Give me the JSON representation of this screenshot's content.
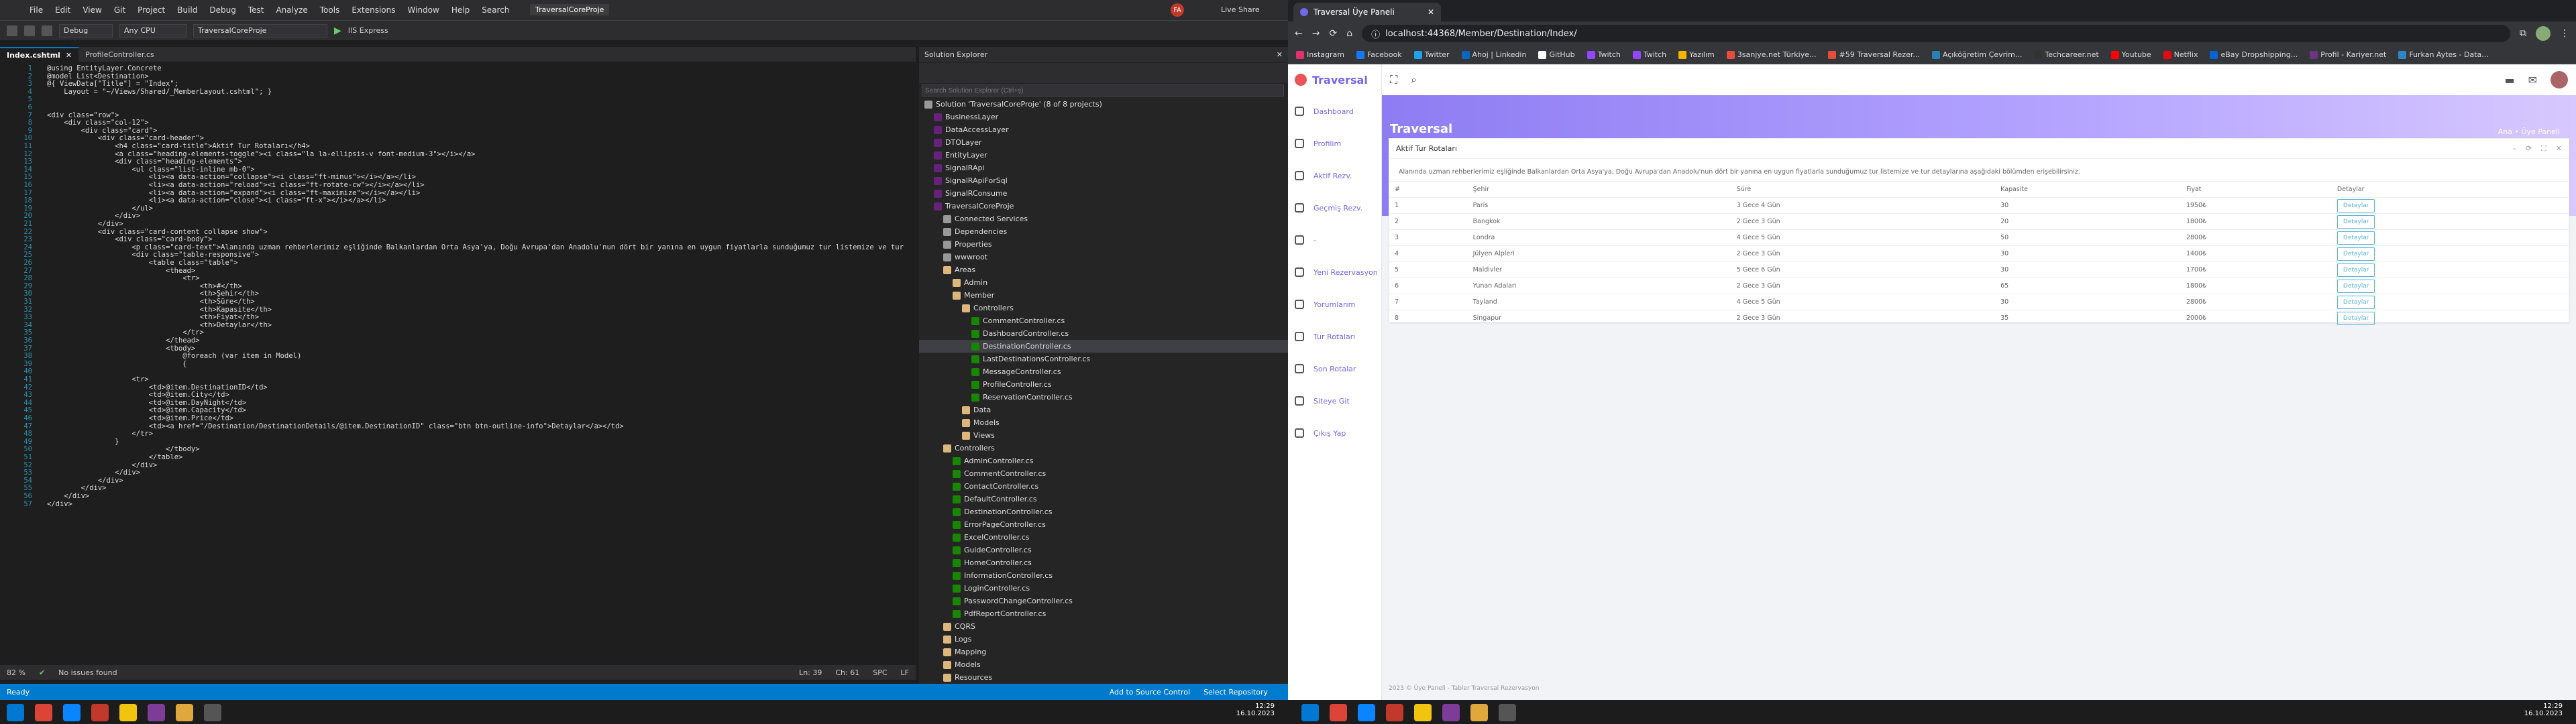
{
  "vs": {
    "menu": [
      "File",
      "Edit",
      "View",
      "Git",
      "Project",
      "Build",
      "Debug",
      "Test",
      "Analyze",
      "Tools",
      "Extensions",
      "Window",
      "Help",
      "Search"
    ],
    "solution_name": "TraversalCoreProje",
    "user_initials": "FA",
    "live_share": "Live Share",
    "config": "Debug",
    "platform": "Any CPU",
    "startup": "TraversalCoreProje",
    "run_target": "IIS Express",
    "tabs": [
      {
        "label": "Index.cshtml"
      },
      {
        "label": "ProfileController.cs"
      }
    ],
    "code_lines": [
      "@using EntityLayer.Concrete",
      "@model List<Destination>",
      "@{ ViewData[\"Title\"] = \"Index\";",
      "    Layout = \"~/Views/Shared/_MemberLayout.cshtml\"; }",
      "",
      "",
      "<div class=\"row\">",
      "    <div class=\"col-12\">",
      "        <div class=\"card\">",
      "            <div class=\"card-header\">",
      "                <h4 class=\"card-title\">Aktif Tur Rotaları</h4>",
      "                <a class=\"heading-elements-toggle\"><i class=\"la la-ellipsis-v font-medium-3\"></i></a>",
      "                <div class=\"heading-elements\">",
      "                    <ul class=\"list-inline mb-0\">",
      "                        <li><a data-action=\"collapse\"><i class=\"ft-minus\"></i></a></li>",
      "                        <li><a data-action=\"reload\"><i class=\"ft-rotate-cw\"></i></a></li>",
      "                        <li><a data-action=\"expand\"><i class=\"ft-maximize\"></i></a></li>",
      "                        <li><a data-action=\"close\"><i class=\"ft-x\"></i></a></li>",
      "                    </ul>",
      "                </div>",
      "            </div>",
      "            <div class=\"card-content collapse show\">",
      "                <div class=\"card-body\">",
      "                    <p class=\"card-text\">Alanında uzman rehberlerimiz eşliğinde Balkanlardan Orta Asya'ya, Doğu Avrupa'dan Anadolu'nun dört bir yanına en uygun fiyatlarla sunduğumuz tur listemize ve tur",
      "                    <div class=\"table-responsive\">",
      "                        <table class=\"table\">",
      "                            <thead>",
      "                                <tr>",
      "                                    <th>#</th>",
      "                                    <th>Şehir</th>",
      "                                    <th>Süre</th>",
      "                                    <th>Kapasite</th>",
      "                                    <th>Fiyat</th>",
      "                                    <th>Detaylar</th>",
      "                                </tr>",
      "                            </thead>",
      "                            <tbody>",
      "                                @foreach (var item in Model)",
      "                                {",
      "",
      "                    <tr>",
      "                        <td>@item.DestinationID</td>",
      "                        <td>@item.City</td>",
      "                        <td>@item.DayNight</td>",
      "                        <td>@item.Capacity</td>",
      "                        <td>@item.Price</td>",
      "                        <td><a href=\"/Destination/DestinationDetails/@item.DestinationID\" class=\"btn btn-outline-info\">Detaylar</a></td>",
      "                    </tr>",
      "                }",
      "                            </tbody>",
      "                        </table>",
      "                    </div>",
      "                </div>",
      "            </div>",
      "        </div>",
      "    </div>",
      "</div>"
    ],
    "editor_status": {
      "zoom": "82 %",
      "issues": "No issues found",
      "ln": "Ln: 39",
      "ch": "Ch: 61",
      "enc": "SPC",
      "eol": "LF"
    },
    "status": {
      "ready": "Ready",
      "source_control": "Add to Source Control",
      "repo": "Select Repository"
    },
    "solution_explorer": {
      "title": "Solution Explorer",
      "search_placeholder": "Search Solution Explorer (Ctrl+ş)",
      "nodes": [
        {
          "label": "Solution 'TraversalCoreProje' (8 of 8 projects)",
          "depth": 0,
          "type": "file"
        },
        {
          "label": "BusinessLayer",
          "depth": 1,
          "type": "proj"
        },
        {
          "label": "DataAccessLayer",
          "depth": 1,
          "type": "proj"
        },
        {
          "label": "DTOLayer",
          "depth": 1,
          "type": "proj"
        },
        {
          "label": "EntityLayer",
          "depth": 1,
          "type": "proj"
        },
        {
          "label": "SignalRApi",
          "depth": 1,
          "type": "proj"
        },
        {
          "label": "SignalRApiForSql",
          "depth": 1,
          "type": "proj"
        },
        {
          "label": "SignalRConsume",
          "depth": 1,
          "type": "proj"
        },
        {
          "label": "TraversalCoreProje",
          "depth": 1,
          "type": "proj"
        },
        {
          "label": "Connected Services",
          "depth": 2,
          "type": "file"
        },
        {
          "label": "Dependencies",
          "depth": 2,
          "type": "file"
        },
        {
          "label": "Properties",
          "depth": 2,
          "type": "file"
        },
        {
          "label": "wwwroot",
          "depth": 2,
          "type": "file"
        },
        {
          "label": "Areas",
          "depth": 2,
          "type": "folder"
        },
        {
          "label": "Admin",
          "depth": 3,
          "type": "folder"
        },
        {
          "label": "Member",
          "depth": 3,
          "type": "folder"
        },
        {
          "label": "Controllers",
          "depth": 4,
          "type": "folder"
        },
        {
          "label": "CommentController.cs",
          "depth": 5,
          "type": "cs"
        },
        {
          "label": "DashboardController.cs",
          "depth": 5,
          "type": "cs"
        },
        {
          "label": "DestinationController.cs",
          "depth": 5,
          "type": "cs"
        },
        {
          "label": "LastDestinationsController.cs",
          "depth": 5,
          "type": "cs"
        },
        {
          "label": "MessageController.cs",
          "depth": 5,
          "type": "cs"
        },
        {
          "label": "ProfileController.cs",
          "depth": 5,
          "type": "cs"
        },
        {
          "label": "ReservationController.cs",
          "depth": 5,
          "type": "cs"
        },
        {
          "label": "Data",
          "depth": 4,
          "type": "folder"
        },
        {
          "label": "Models",
          "depth": 4,
          "type": "folder"
        },
        {
          "label": "Views",
          "depth": 4,
          "type": "folder"
        },
        {
          "label": "Controllers",
          "depth": 2,
          "type": "folder"
        },
        {
          "label": "AdminController.cs",
          "depth": 3,
          "type": "cs"
        },
        {
          "label": "CommentController.cs",
          "depth": 3,
          "type": "cs"
        },
        {
          "label": "ContactController.cs",
          "depth": 3,
          "type": "cs"
        },
        {
          "label": "DefaultController.cs",
          "depth": 3,
          "type": "cs"
        },
        {
          "label": "DestinationController.cs",
          "depth": 3,
          "type": "cs"
        },
        {
          "label": "ErrorPageController.cs",
          "depth": 3,
          "type": "cs"
        },
        {
          "label": "ExcelController.cs",
          "depth": 3,
          "type": "cs"
        },
        {
          "label": "GuideController.cs",
          "depth": 3,
          "type": "cs"
        },
        {
          "label": "HomeController.cs",
          "depth": 3,
          "type": "cs"
        },
        {
          "label": "InformationController.cs",
          "depth": 3,
          "type": "cs"
        },
        {
          "label": "LoginController.cs",
          "depth": 3,
          "type": "cs"
        },
        {
          "label": "PasswordChangeController.cs",
          "depth": 3,
          "type": "cs"
        },
        {
          "label": "PdfReportController.cs",
          "depth": 3,
          "type": "cs"
        },
        {
          "label": "CQRS",
          "depth": 2,
          "type": "folder"
        },
        {
          "label": "Logs",
          "depth": 2,
          "type": "folder"
        },
        {
          "label": "Mapping",
          "depth": 2,
          "type": "folder"
        },
        {
          "label": "Models",
          "depth": 2,
          "type": "folder"
        },
        {
          "label": "Resources",
          "depth": 2,
          "type": "folder"
        }
      ],
      "selected_index": 19
    }
  },
  "chrome": {
    "tab_title": "Traversal Üye Paneli",
    "url": "localhost:44368/Member/Destination/Index/",
    "bookmarks": [
      "Instagram",
      "Facebook",
      "Twitter",
      "Ahoj | Linkedin",
      "GitHub",
      "Twitch",
      "Twitch",
      "Yazılım",
      "3sanjye.net Türkiye...",
      "#59 Traversal Rezer...",
      "Açıköğretim Çevrim...",
      "Techcareer.net",
      "Youtube",
      "Netflix",
      "eBay Dropshipping...",
      "Profil - Kariyer.net",
      "Furkan Aytes - Data..."
    ]
  },
  "app": {
    "brand": "Traversal",
    "nav": [
      "Dashboard",
      "Profilim",
      "Aktif Rezv.",
      "Geçmiş Rezv.",
      "-",
      "Yeni Rezervasyon",
      "Yorumlarım",
      "Tur Rotaları",
      "Son Rotalar",
      "Siteye Git",
      "Çıkış Yap"
    ],
    "page_title": "Traversal",
    "breadcrumb": "Ana  •  Üye Paneli",
    "card_title": "Aktif Tur Rotaları",
    "card_text": "Alanında uzman rehberlerimiz eşliğinde Balkanlardan Orta Asya'ya, Doğu Avrupa'dan Anadolu'nun dört bir yanına en uygun fiyatlarla sunduğumuz tur listemize ve tur detaylarına aşağıdaki bölümden erişebilirsiniz.",
    "columns": [
      "#",
      "Şehir",
      "Süre",
      "Kapasite",
      "Fiyat",
      "Detaylar"
    ],
    "rows": [
      [
        "1",
        "Paris",
        "3 Gece 4 Gün",
        "30",
        "1950₺"
      ],
      [
        "2",
        "Bangkok",
        "2 Gece 3 Gün",
        "20",
        "1800₺"
      ],
      [
        "3",
        "Londra",
        "4 Gece 5 Gün",
        "50",
        "2800₺"
      ],
      [
        "4",
        "Jülyen Alpleri",
        "2 Gece 3 Gün",
        "30",
        "1400₺"
      ],
      [
        "5",
        "Maldivler",
        "5 Gece 6 Gün",
        "30",
        "1700₺"
      ],
      [
        "6",
        "Yunan Adaları",
        "2 Gece 3 Gün",
        "65",
        "1800₺"
      ],
      [
        "7",
        "Tayland",
        "4 Gece 5 Gün",
        "30",
        "2800₺"
      ],
      [
        "8",
        "Singapur",
        "2 Gece 3 Gün",
        "35",
        "2000₺"
      ]
    ],
    "details_label": "Detaylar",
    "footer": "2023 © Üye Paneli - Tabler Traversal Rezervasyon"
  },
  "taskbar": {
    "time": "12:29",
    "date": "16.10.2023"
  }
}
